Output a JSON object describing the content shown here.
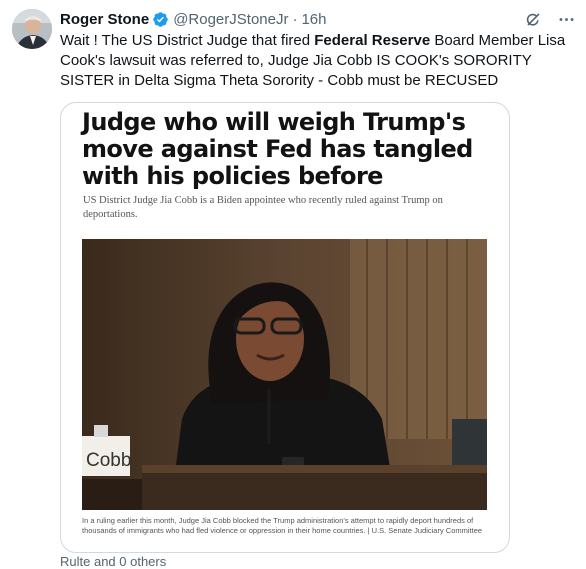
{
  "tweet": {
    "author": "Roger Stone",
    "handle": "@RogerJStoneJr",
    "time": "16h",
    "text_parts": [
      "Wait ! The US District Judge that fired ",
      "Federal Reserve",
      " Board Member Lisa Cook's lawsuit was referred to, Judge Jia Cobb IS COOK's SORORITY SISTER in Delta Sigma Theta Sorority - Cobb must be RECUSED"
    ]
  },
  "article": {
    "headline": "Judge who will weigh Trump's move against Fed has tangled with his policies before",
    "deck": "US District Judge Jia Cobb is a Biden appointee who recently ruled against Trump on deportations.",
    "nameplate": "Cobb",
    "caption": "In a ruling earlier this month, Judge Jia Cobb blocked the Trump administration's attempt to rapidly deport hundreds of thousands of immigrants who had fled violence or oppression in their home countries. | U.S. Senate Judiciary Committee"
  },
  "footer": {
    "social_context": "Rulte and 0 others"
  },
  "icons": [
    "avatar",
    "verified-badge-icon",
    "grok-icon",
    "more-icon"
  ],
  "colors": {
    "verified": "#1d9bf0",
    "secondary_text": "#536471",
    "card_border": "#cfd9de"
  }
}
